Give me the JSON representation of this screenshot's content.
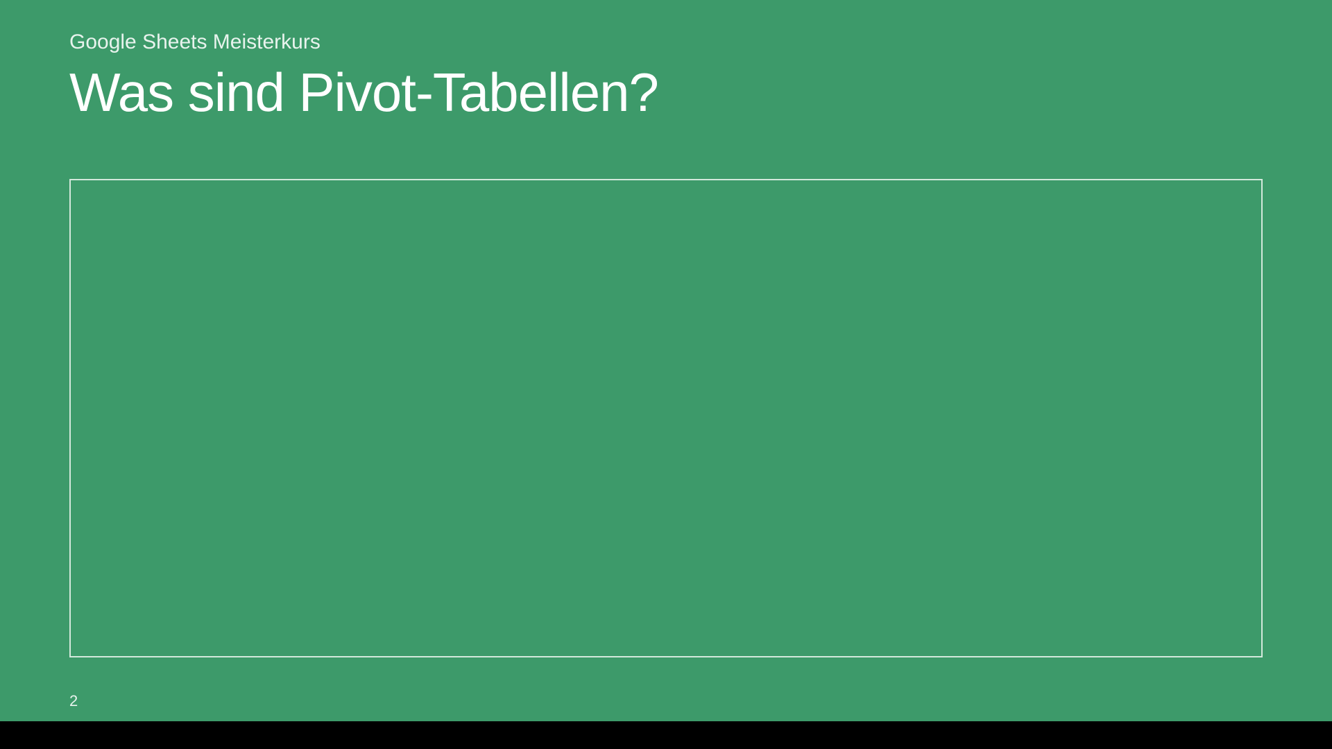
{
  "slide": {
    "subtitle": "Google Sheets Meisterkurs",
    "title": "Was sind Pivot-Tabellen?",
    "page_number": "2"
  },
  "colors": {
    "background": "#3d9a6a",
    "text": "#ffffff",
    "border": "#d4e9dc"
  }
}
